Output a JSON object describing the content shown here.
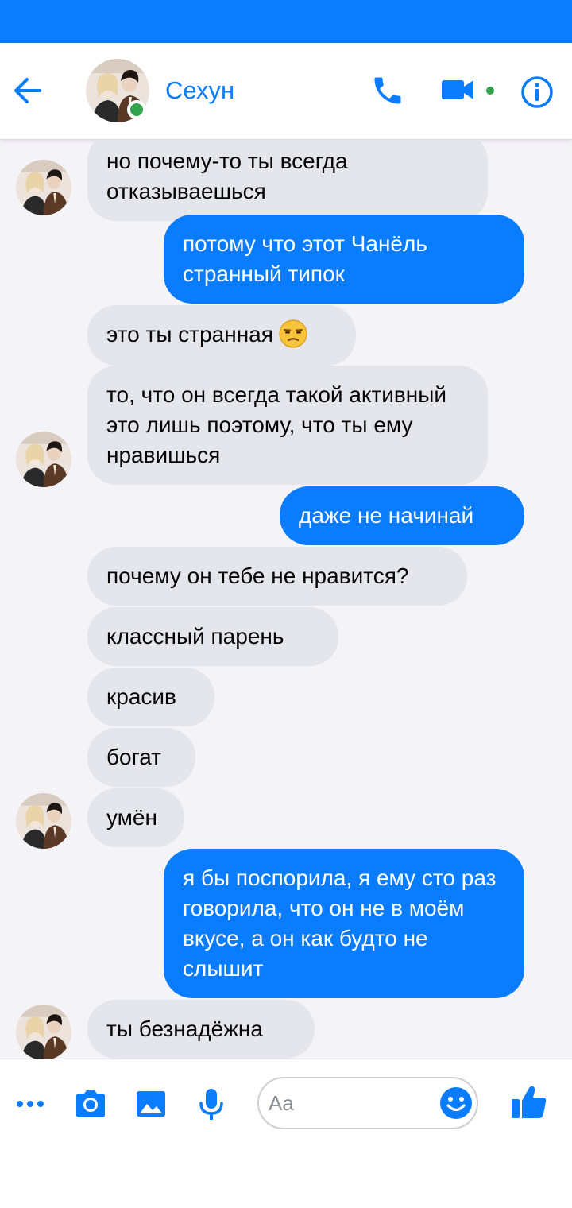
{
  "colors": {
    "accent": "#0a7cff",
    "online": "#31a24c",
    "incoming_bubble": "#e4e6eb",
    "outgoing_bubble": "#0a7cff"
  },
  "header": {
    "back_icon": "arrow-left-icon",
    "contact_name": "Сехун",
    "call_icon": "phone-icon",
    "video_icon": "video-camera-icon",
    "info_icon": "info-icon"
  },
  "messages": [
    {
      "side": "in",
      "text": "но почему-то ты всегда отказываешься"
    },
    {
      "side": "out",
      "text": "потому что этот Чанёль странный типок"
    },
    {
      "side": "in",
      "text": "это ты странная",
      "emoji": "unamused-face"
    },
    {
      "side": "in",
      "text": "то, что он всегда такой активный это лишь поэтому, что ты ему нравишься"
    },
    {
      "side": "out",
      "text": "даже не начинай"
    },
    {
      "side": "in",
      "text": "почему он тебе не нравится?"
    },
    {
      "side": "in",
      "text": "классный парень"
    },
    {
      "side": "in",
      "text": "красив"
    },
    {
      "side": "in",
      "text": "богат"
    },
    {
      "side": "in",
      "text": "умён"
    },
    {
      "side": "out",
      "text": "я бы поспорила, я ему сто раз говорила, что он не в моём вкусе, а он как будто не слышит"
    },
    {
      "side": "in",
      "text": "ты безнадёжна"
    }
  ],
  "composer": {
    "more_icon": "more-dots-icon",
    "camera_icon": "camera-icon",
    "gallery_icon": "image-icon",
    "mic_icon": "microphone-icon",
    "placeholder": "Aa",
    "emoji_icon": "smiley-icon",
    "like_icon": "thumbs-up-icon"
  }
}
